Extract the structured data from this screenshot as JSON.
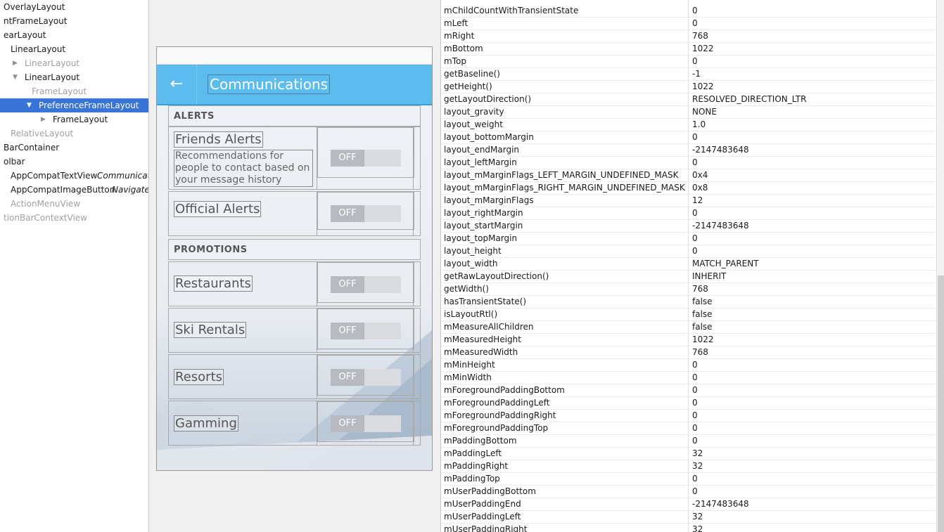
{
  "tree": [
    {
      "label": "OverlayLayout",
      "indent": 0,
      "arrow": "",
      "dim": false,
      "selected": false
    },
    {
      "label": "ntFrameLayout",
      "indent": 0,
      "arrow": "",
      "dim": false,
      "selected": false
    },
    {
      "label": "earLayout",
      "indent": 0,
      "arrow": "",
      "dim": false,
      "selected": false
    },
    {
      "label": "LinearLayout",
      "indent": 1,
      "arrow": "",
      "dim": false,
      "selected": false
    },
    {
      "label": "LinearLayout",
      "indent": 2,
      "arrow": "▶",
      "dim": true,
      "selected": false
    },
    {
      "label": "LinearLayout",
      "indent": 2,
      "arrow": "▼",
      "dim": false,
      "selected": false
    },
    {
      "label": "FrameLayout",
      "indent": 4,
      "arrow": "",
      "dim": true,
      "selected": false
    },
    {
      "label": "PreferenceFrameLayout",
      "indent": 4,
      "arrow": "▼",
      "dim": false,
      "selected": true
    },
    {
      "label": "FrameLayout",
      "indent": 6,
      "arrow": "▶",
      "dim": false,
      "selected": false
    },
    {
      "label": "RelativeLayout",
      "indent": 1,
      "arrow": "",
      "dim": true,
      "selected": false
    },
    {
      "label": "BarContainer",
      "indent": 0,
      "arrow": "",
      "dim": false,
      "selected": false
    },
    {
      "label": "olbar",
      "indent": 0,
      "arrow": "",
      "dim": false,
      "selected": false
    },
    {
      "label": "AppCompatTextView",
      "desc": "Communications",
      "indent": 1,
      "arrow": "",
      "dim": false,
      "selected": false
    },
    {
      "label": "AppCompatImageButton",
      "desc": "Navigate up",
      "indent": 1,
      "arrow": "",
      "dim": false,
      "selected": false
    },
    {
      "label": "ActionMenuView",
      "indent": 1,
      "arrow": "",
      "dim": true,
      "selected": false
    },
    {
      "label": "tionBarContextView",
      "indent": 0,
      "arrow": "",
      "dim": true,
      "selected": false
    }
  ],
  "device": {
    "toolbar_title": "Communications",
    "back_icon": "arrow-left-icon",
    "alerts_header": "ALERTS",
    "promotions_header": "PROMOTIONS",
    "rows": [
      {
        "title": "Friends Alerts",
        "summary": "Recommendations for people to contact based on your message history",
        "switch": "OFF"
      },
      {
        "title": "Official Alerts",
        "switch": "OFF"
      },
      {
        "title": "Restaurants",
        "switch": "OFF"
      },
      {
        "title": "Ski Rentals",
        "switch": "OFF"
      },
      {
        "title": "Resorts",
        "switch": "OFF"
      },
      {
        "title": "Gamming",
        "switch": "OFF"
      }
    ],
    "toolbar_color": "#5cbcee"
  },
  "properties": [
    [
      "mChildCountWithTransientState",
      "0"
    ],
    [
      "mLeft",
      "0"
    ],
    [
      "mRight",
      "768"
    ],
    [
      "mBottom",
      "1022"
    ],
    [
      "mTop",
      "0"
    ],
    [
      "getBaseline()",
      "-1"
    ],
    [
      "getHeight()",
      "1022"
    ],
    [
      "getLayoutDirection()",
      "RESOLVED_DIRECTION_LTR"
    ],
    [
      "layout_gravity",
      "NONE"
    ],
    [
      "layout_weight",
      "1.0"
    ],
    [
      "layout_bottomMargin",
      "0"
    ],
    [
      "layout_endMargin",
      "-2147483648"
    ],
    [
      "layout_leftMargin",
      "0"
    ],
    [
      "layout_mMarginFlags_LEFT_MARGIN_UNDEFINED_MASK",
      "0x4"
    ],
    [
      "layout_mMarginFlags_RIGHT_MARGIN_UNDEFINED_MASK",
      "0x8"
    ],
    [
      "layout_mMarginFlags",
      "12"
    ],
    [
      "layout_rightMargin",
      "0"
    ],
    [
      "layout_startMargin",
      "-2147483648"
    ],
    [
      "layout_topMargin",
      "0"
    ],
    [
      "layout_height",
      "0"
    ],
    [
      "layout_width",
      "MATCH_PARENT"
    ],
    [
      "getRawLayoutDirection()",
      "INHERIT"
    ],
    [
      "getWidth()",
      "768"
    ],
    [
      "hasTransientState()",
      "false"
    ],
    [
      "isLayoutRtl()",
      "false"
    ],
    [
      "mMeasureAllChildren",
      "false"
    ],
    [
      "mMeasuredHeight",
      "1022"
    ],
    [
      "mMeasuredWidth",
      "768"
    ],
    [
      "mMinHeight",
      "0"
    ],
    [
      "mMinWidth",
      "0"
    ],
    [
      "mForegroundPaddingBottom",
      "0"
    ],
    [
      "mForegroundPaddingLeft",
      "0"
    ],
    [
      "mForegroundPaddingRight",
      "0"
    ],
    [
      "mForegroundPaddingTop",
      "0"
    ],
    [
      "mPaddingBottom",
      "0"
    ],
    [
      "mPaddingLeft",
      "32"
    ],
    [
      "mPaddingRight",
      "32"
    ],
    [
      "mPaddingTop",
      "0"
    ],
    [
      "mUserPaddingBottom",
      "0"
    ],
    [
      "mUserPaddingEnd",
      "-2147483648"
    ],
    [
      "mUserPaddingLeft",
      "32"
    ],
    [
      "mUserPaddingRight",
      "32"
    ]
  ]
}
